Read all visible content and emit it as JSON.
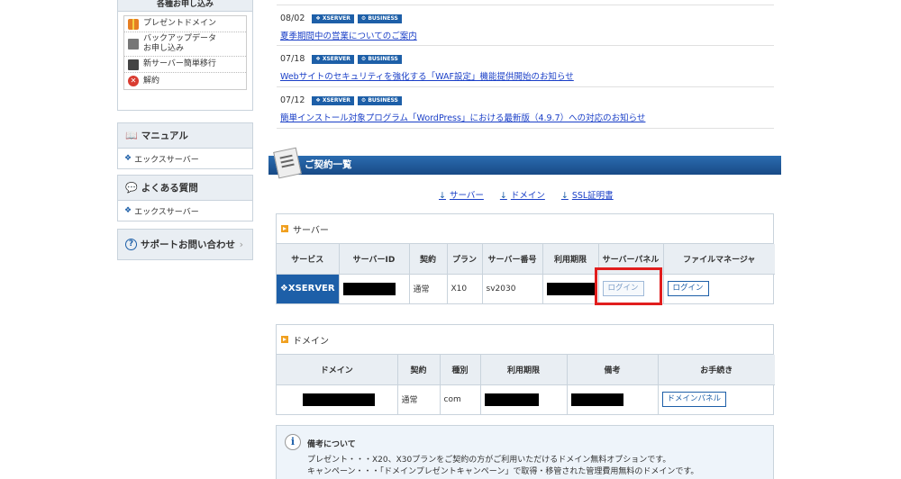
{
  "sidebar": {
    "apply": {
      "title": "各種お申し込み",
      "items": [
        {
          "label": "プレゼントドメイン",
          "icon": "gift-icon"
        },
        {
          "label": "バックアップデータ\nお申し込み",
          "icon": "backup-icon"
        },
        {
          "label": "新サーバー簡単移行",
          "icon": "server-migrate-icon"
        },
        {
          "label": "解約",
          "icon": "cancel-icon"
        }
      ]
    },
    "manual": {
      "title": "マニュアル",
      "icon": "book-icon",
      "item": "エックスサーバー"
    },
    "faq": {
      "title": "よくある質問",
      "icon": "speech-bubble-icon",
      "item": "エックスサーバー"
    },
    "support": {
      "label": "サポートお問い合わせ",
      "icon": "question-icon"
    }
  },
  "news": [
    {
      "date": "08/02",
      "tags": [
        "XSERVER",
        "BUSINESS"
      ],
      "title": "夏季期間中の営業についてのご案内"
    },
    {
      "date": "07/18",
      "tags": [
        "XSERVER",
        "BUSINESS"
      ],
      "title": "Webサイトのセキュリティを強化する「WAF設定」機能提供開始のお知らせ"
    },
    {
      "date": "07/12",
      "tags": [
        "XSERVER",
        "BUSINESS"
      ],
      "title": "簡単インストール対象プログラム「WordPress」における最新版（4.9.7）への対応のお知らせ"
    }
  ],
  "contracts": {
    "title": "ご契約一覧",
    "anchors": [
      "サーバー",
      "ドメイン",
      "SSL証明書"
    ]
  },
  "server_table": {
    "title": "サーバー",
    "headers": [
      "サービス",
      "サーバーID",
      "契約",
      "プラン",
      "サーバー番号",
      "利用期限",
      "サーバーパネル",
      "ファイルマネージャ"
    ],
    "row": {
      "service": "XSERVER",
      "contract": "通常",
      "plan": "X10",
      "server_no": "sv2030",
      "panel_btn": "ログイン",
      "fm_btn": "ログイン"
    }
  },
  "domain_table": {
    "title": "ドメイン",
    "headers": [
      "ドメイン",
      "契約",
      "種別",
      "利用期限",
      "備考",
      "お手続き"
    ],
    "row": {
      "contract": "通常",
      "type": "com",
      "action_btn": "ドメインパネル"
    }
  },
  "note": {
    "title": "備考について",
    "line1": "プレゼント・・・X20、X30プランをご契約の方がご利用いただけるドメイン無料オプションです。",
    "line2": "キャンペーン・・・「ドメインプレゼントキャンペーン」で取得・移管された管理費用無料のドメインです。"
  },
  "colors": {
    "accent": "#1d5fa8",
    "highlight": "#e11d1d",
    "header_bg": "#e9eef3"
  }
}
